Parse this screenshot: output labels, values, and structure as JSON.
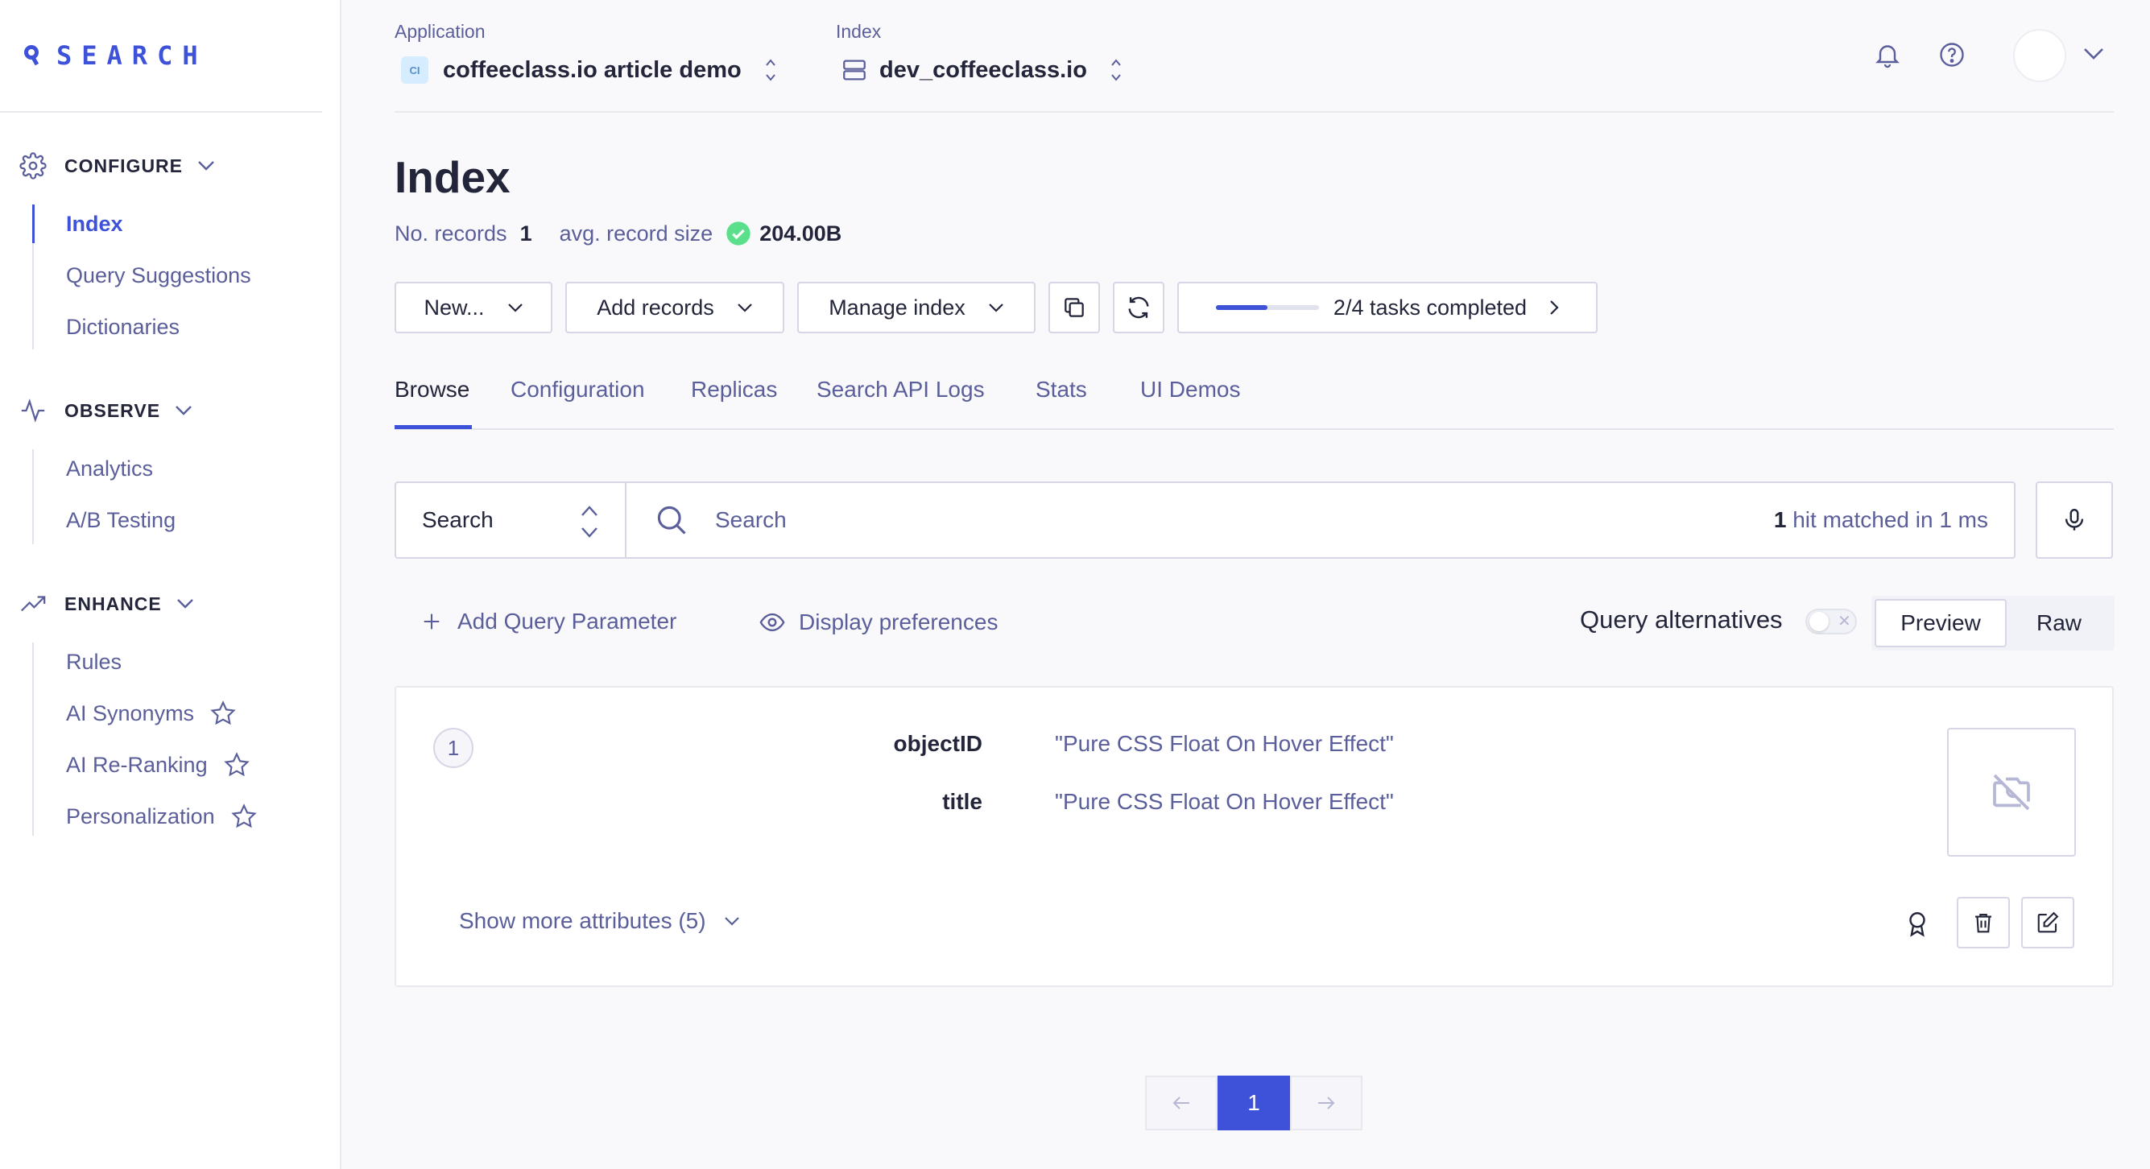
{
  "sidebar": {
    "logo_text": "SEARCH",
    "sections": [
      {
        "label": "CONFIGURE",
        "icon": "gear-icon",
        "items": [
          {
            "label": "Index",
            "active": true
          },
          {
            "label": "Query Suggestions"
          },
          {
            "label": "Dictionaries"
          }
        ]
      },
      {
        "label": "OBSERVE",
        "icon": "pulse-icon",
        "items": [
          {
            "label": "Analytics"
          },
          {
            "label": "A/B Testing"
          }
        ]
      },
      {
        "label": "ENHANCE",
        "icon": "trend-icon",
        "items": [
          {
            "label": "Rules"
          },
          {
            "label": "AI Synonyms",
            "star": true
          },
          {
            "label": "AI Re-Ranking",
            "star": true
          },
          {
            "label": "Personalization",
            "star": true
          }
        ]
      }
    ]
  },
  "header": {
    "application_label": "Application",
    "application_badge": "CI",
    "application_value": "coffeeclass.io article demo",
    "index_label": "Index",
    "index_value": "dev_coffeeclass.io"
  },
  "page": {
    "title": "Index",
    "records_label": "No. records",
    "records_value": "1",
    "size_label": "avg. record size",
    "size_value": "204.00B"
  },
  "toolbar": {
    "new_label": "New...",
    "add_records_label": "Add records",
    "manage_index_label": "Manage index",
    "tasks_label": "2/4 tasks completed",
    "tasks_progress": 0.5
  },
  "tabs": [
    "Browse",
    "Configuration",
    "Replicas",
    "Search API Logs",
    "Stats",
    "UI Demos"
  ],
  "search": {
    "mode": "Search",
    "placeholder": "Search",
    "hits_count": "1",
    "hits_text": " hit matched in 1 ms"
  },
  "options": {
    "add_param_label": "Add Query Parameter",
    "display_pref_label": "Display preferences",
    "query_alt_label": "Query alternatives",
    "query_alt_enabled": false,
    "view_preview": "Preview",
    "view_raw": "Raw"
  },
  "record": {
    "position": "1",
    "attributes": [
      {
        "key": "objectID",
        "value": "\"Pure CSS Float On Hover Effect\""
      },
      {
        "key": "title",
        "value": "\"Pure CSS Float On Hover Effect\""
      }
    ],
    "show_more_label": "Show more attributes (5)"
  },
  "pagination": {
    "current": "1"
  },
  "colors": {
    "accent": "#3d52d8",
    "text": "#23263b",
    "muted": "#5a5e9a",
    "success": "#5adf8a"
  }
}
